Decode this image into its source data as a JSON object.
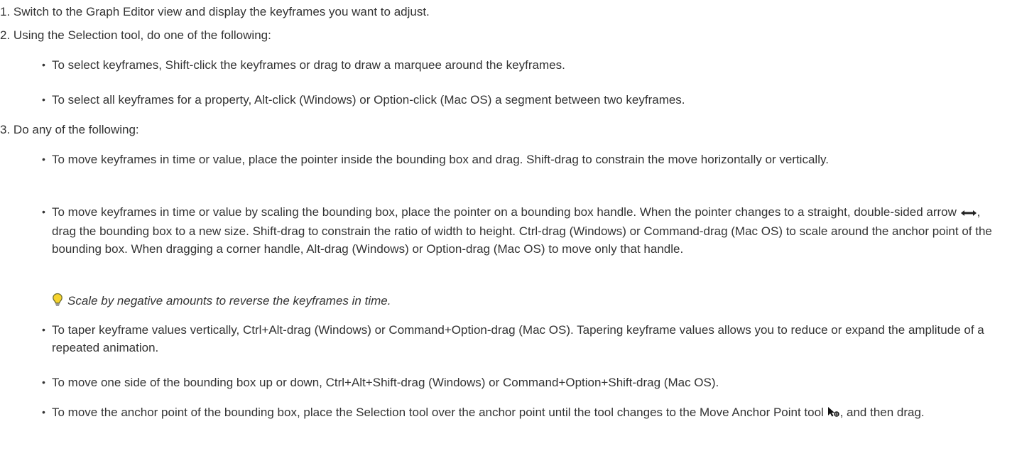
{
  "steps": [
    {
      "num": "1.",
      "text": "Switch to the Graph Editor view and display the keyframes you want to adjust."
    },
    {
      "num": "2.",
      "text": "Using the Selection tool, do one of the following:"
    },
    {
      "num": "3.",
      "text": "Do any of the following:"
    }
  ],
  "step2_bullets": [
    "To select keyframes, Shift-click the keyframes or drag to draw a marquee around the keyframes.",
    "To select all keyframes for a property, Alt-click (Windows) or Option-click (Mac OS) a segment between two keyframes."
  ],
  "step3_bullets": {
    "b1": "To move keyframes in time or value, place the pointer inside the bounding box and drag. Shift-drag to constrain the move horizontally or vertically.",
    "b2_pre": "To move keyframes in time or value by scaling the bounding box, place the pointer on a bounding box handle. When the pointer changes to a straight, double-sided arrow ",
    "b2_post": ", drag the bounding box to a new size. Shift-drag to constrain the ratio of width to height. Ctrl-drag (Windows) or Command-drag (Mac OS) to scale around the anchor point of the bounding box. When dragging a corner handle, Alt-drag (Windows) or Option-drag (Mac OS) to move only that handle.",
    "tip": "Scale by negative amounts to reverse the keyframes in time.",
    "b3": "To taper keyframe values vertically, Ctrl+Alt-drag (Windows) or Command+Option-drag (Mac OS). Tapering keyframe values allows you to reduce or expand the amplitude of a repeated animation.",
    "b4": "To move one side of the bounding box up or down, Ctrl+Alt+Shift-drag (Windows) or Command+Option+Shift-drag (Mac OS).",
    "b5_pre": "To move the anchor point of the bounding box, place the Selection tool over the anchor point until the tool changes to the Move Anchor Point tool ",
    "b5_post": ", and then drag."
  },
  "icons": {
    "tip": "lightbulb-icon",
    "arrow": "double-sided-arrow-icon",
    "anchor_tool": "move-anchor-point-tool-icon"
  }
}
